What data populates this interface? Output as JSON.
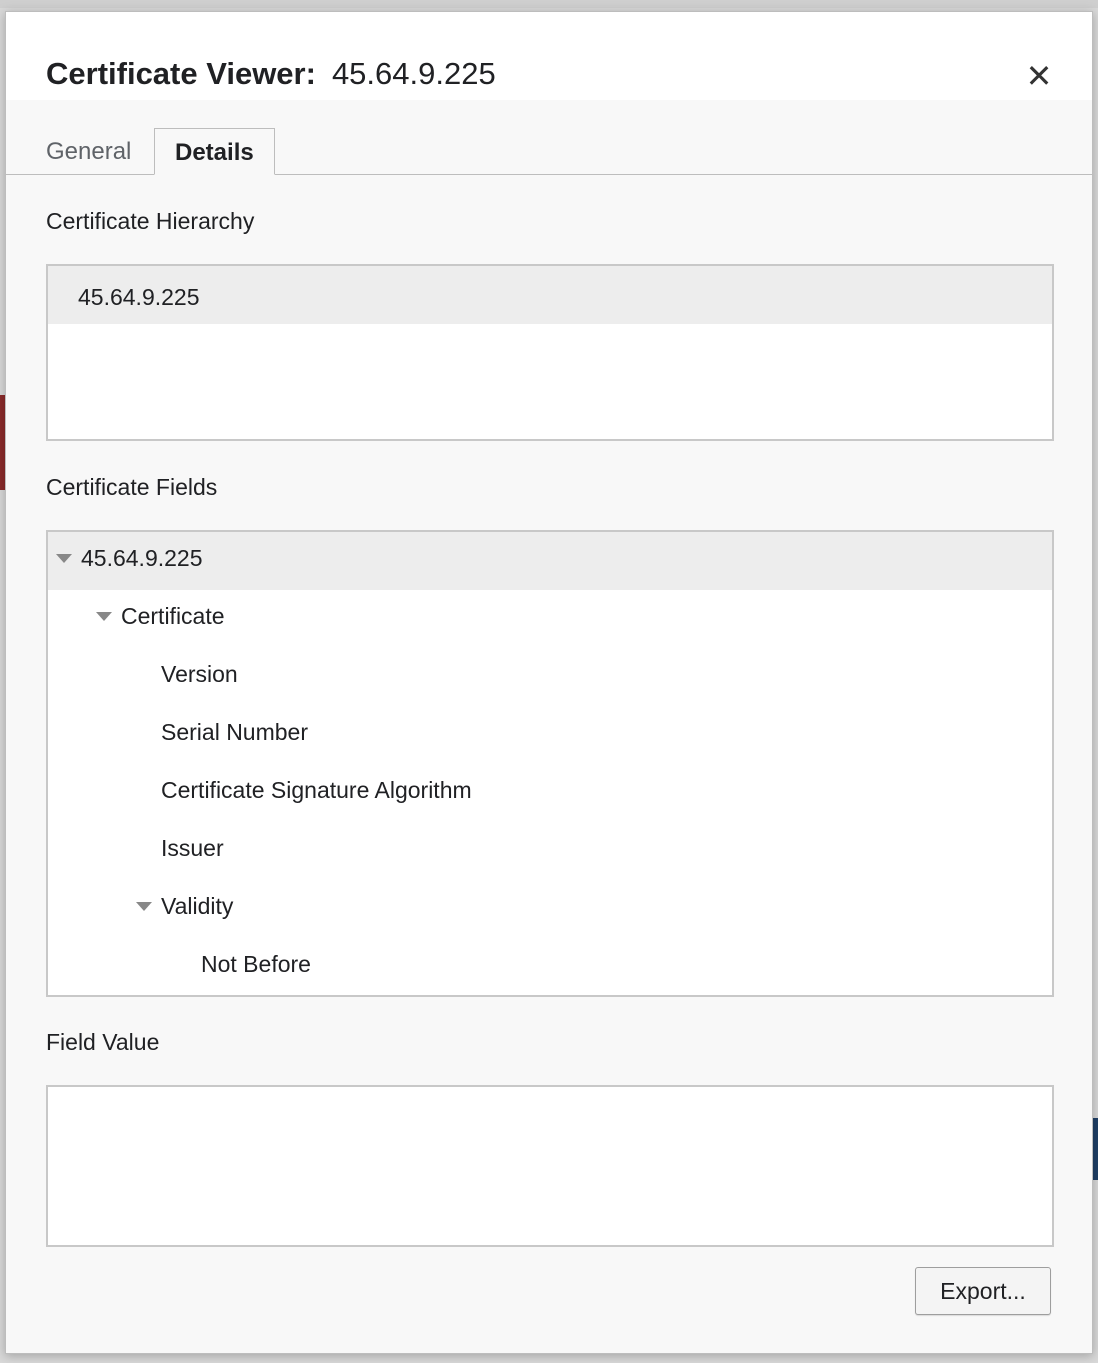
{
  "dialog": {
    "title": "Certificate Viewer:",
    "host": "45.64.9.225",
    "close_label": "✕"
  },
  "tabs": [
    {
      "label": "General",
      "active": false
    },
    {
      "label": "Details",
      "active": true
    }
  ],
  "hierarchy": {
    "label": "Certificate Hierarchy",
    "items": [
      "45.64.9.225"
    ]
  },
  "fields": {
    "label": "Certificate Fields",
    "items": [
      {
        "label": "45.64.9.225",
        "level": 0,
        "expanded": true,
        "selected": true
      },
      {
        "label": "Certificate",
        "level": 1,
        "expanded": true
      },
      {
        "label": "Version",
        "level": 2
      },
      {
        "label": "Serial Number",
        "level": 2
      },
      {
        "label": "Certificate Signature Algorithm",
        "level": 2
      },
      {
        "label": "Issuer",
        "level": 2
      },
      {
        "label": "Validity",
        "level": 2,
        "expanded": true
      },
      {
        "label": "Not Before",
        "level": 3
      }
    ]
  },
  "field_value": {
    "label": "Field Value",
    "value": ""
  },
  "buttons": {
    "export_label": "Export..."
  },
  "icons": {
    "close": "close-icon",
    "expand": "triangle-down-icon"
  }
}
